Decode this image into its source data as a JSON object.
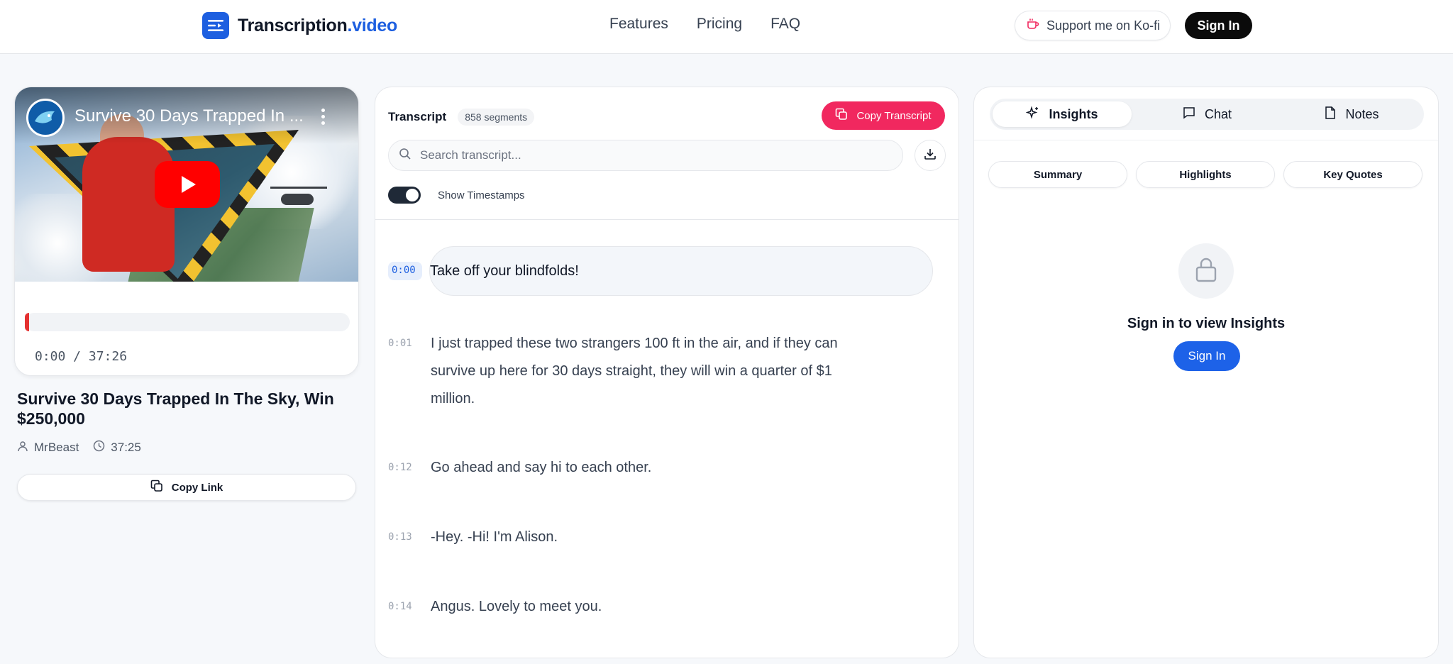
{
  "header": {
    "logo_main": "Transcription",
    "logo_accent": ".video",
    "nav": [
      "Features",
      "Pricing",
      "FAQ"
    ],
    "kofi_label": "Support me on Ko-fi",
    "signin_label": "Sign In"
  },
  "video": {
    "embed_title": "Survive 30 Days Trapped In ...",
    "time_readout": "0:00 / 37:26",
    "progress_fraction": 0.0,
    "title": "Survive 30 Days Trapped In The Sky, Win $250,000",
    "channel": "MrBeast",
    "duration": "37:25",
    "copy_link_label": "Copy Link"
  },
  "transcript": {
    "title": "Transcript",
    "segments_badge": "858 segments",
    "copy_label": "Copy Transcript",
    "search_placeholder": "Search transcript...",
    "toggle_label": "Show Timestamps",
    "segments": [
      {
        "ts": "0:00",
        "text": "Take off your blindfolds!"
      },
      {
        "ts": "0:01",
        "text": "I just trapped these two strangers 100 ft in the air, and if they can survive up here for 30 days straight, they will win a quarter of $1 million."
      },
      {
        "ts": "0:12",
        "text": "Go ahead and say hi to each other."
      },
      {
        "ts": "0:13",
        "text": "-Hey. -Hi! I'm Alison."
      },
      {
        "ts": "0:14",
        "text": "Angus. Lovely to meet you."
      }
    ]
  },
  "insights": {
    "tabs": [
      "Insights",
      "Chat",
      "Notes"
    ],
    "subtabs": [
      "Summary",
      "Highlights",
      "Key Quotes"
    ],
    "lock_message": "Sign in to view Insights",
    "signin_label": "Sign In"
  },
  "colors": {
    "brand_blue": "#1d5fe0",
    "copy_pink": "#f1285f",
    "youtube_red": "#ff0000"
  }
}
